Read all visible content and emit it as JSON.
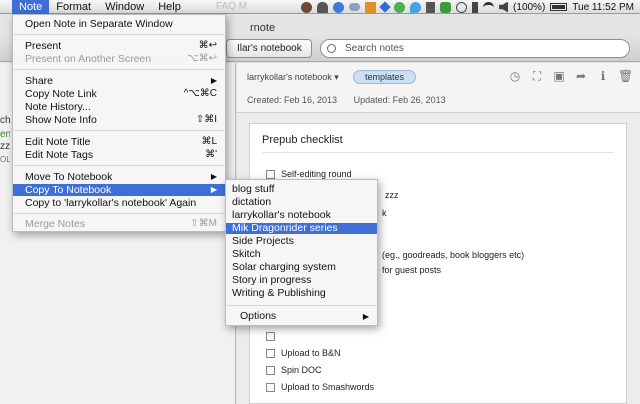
{
  "menubar": {
    "items": [
      "Note",
      "Format",
      "Window",
      "Help"
    ],
    "active_index": 0,
    "faded_title": "FAQ M",
    "battery_text": "(100%)",
    "clock": "Tue 11:52 PM"
  },
  "window": {
    "title": "rnote",
    "notebook_select": "Ilar's notebook",
    "search_placeholder": "Search notes"
  },
  "left_fragments": [
    "ch",
    "en",
    "zz",
    "OLL"
  ],
  "note": {
    "notebook": "larrykollar's notebook",
    "tag": "templates",
    "created": "Created: Feb 16, 2013",
    "updated": "Updated: Feb 26, 2013",
    "title": "Prepub checklist",
    "items_visible": [
      "Self-editing round",
      "zzz",
      "k",
      "(eg., goodreads, book bloggers etc)",
      "for guest posts",
      "Upload to B&N",
      "Spin DOC",
      "Upload to Smashwords"
    ]
  },
  "note_menu": {
    "items": [
      {
        "label": "Open Note in Separate Window",
        "shortcut": "",
        "submenu": false,
        "disabled": false
      },
      {
        "label": "Present",
        "shortcut": "⌘↩",
        "submenu": false,
        "disabled": false
      },
      {
        "label": "Present on Another Screen",
        "shortcut": "⌥⌘↩",
        "submenu": false,
        "disabled": true
      },
      {
        "label": "Share",
        "shortcut": "",
        "submenu": true,
        "disabled": false
      },
      {
        "label": "Copy Note Link",
        "shortcut": "^⌥⌘C",
        "submenu": false,
        "disabled": false
      },
      {
        "label": "Note History...",
        "shortcut": "",
        "submenu": false,
        "disabled": false
      },
      {
        "label": "Show Note Info",
        "shortcut": "⇧⌘I",
        "submenu": false,
        "disabled": false
      },
      {
        "label": "Edit Note Title",
        "shortcut": "⌘L",
        "submenu": false,
        "disabled": false
      },
      {
        "label": "Edit Note Tags",
        "shortcut": "⌘'",
        "submenu": false,
        "disabled": false
      },
      {
        "label": "Move To Notebook",
        "shortcut": "",
        "submenu": true,
        "disabled": false
      },
      {
        "label": "Copy To Notebook",
        "shortcut": "",
        "submenu": true,
        "disabled": false,
        "highlighted": true
      },
      {
        "label": "Copy to 'larrykollar's notebook' Again",
        "shortcut": "",
        "submenu": false,
        "disabled": false
      },
      {
        "label": "Merge Notes",
        "shortcut": "⇧⌘M",
        "submenu": false,
        "disabled": true
      }
    ]
  },
  "copy_submenu": {
    "items": [
      {
        "label": "blog stuff"
      },
      {
        "label": "dictation"
      },
      {
        "label": "larrykollar's notebook"
      },
      {
        "label": "Mik Dragonrider series",
        "highlighted": true
      },
      {
        "label": "Side Projects"
      },
      {
        "label": "Skitch"
      },
      {
        "label": "Solar charging system"
      },
      {
        "label": "Story in progress"
      },
      {
        "label": "Writing & Publishing"
      }
    ],
    "options_label": "Options"
  },
  "colors": {
    "highlight": "#3d6fd7",
    "menu_bg": "#f6f6f6",
    "tag_bg": "#cde0f3"
  }
}
